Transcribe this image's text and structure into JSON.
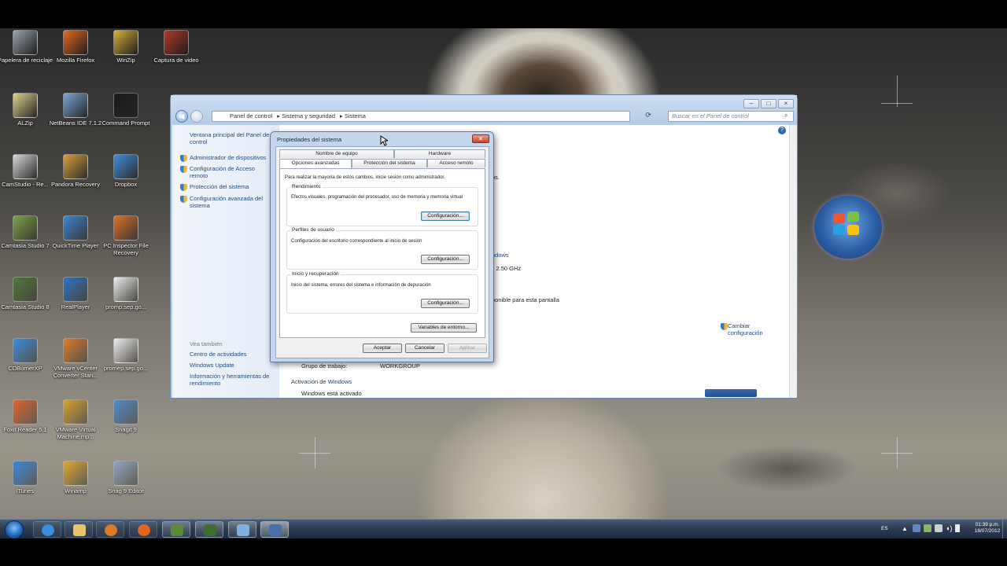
{
  "desktop": {
    "icons": [
      {
        "label": "Papelera de reciclaje",
        "glyph": "recycle-bin-icon",
        "color": "#9aa3ad"
      },
      {
        "label": "Mozilla Firefox",
        "glyph": "firefox-icon",
        "color": "#e66a1e"
      },
      {
        "label": "WinZip",
        "glyph": "winzip-icon",
        "color": "#d9b13a"
      },
      {
        "label": "Captura de video",
        "glyph": "video-folder-icon",
        "color": "#b43a2a"
      },
      {
        "label": "ALZip",
        "glyph": "alzip-icon",
        "color": "#e0d38a"
      },
      {
        "label": "NetBeans IDE 7.1.2",
        "glyph": "netbeans-icon",
        "color": "#7aa7d8"
      },
      {
        "label": "Command Prompt",
        "glyph": "command-prompt-icon",
        "color": "#1b1b1b"
      },
      {
        "label": "CamStudio - Re...",
        "glyph": "camstudio-icon",
        "color": "#d8d8d8"
      },
      {
        "label": "Pandora Recovery",
        "glyph": "pandora-icon",
        "color": "#d7a23a"
      },
      {
        "label": "Dropbox",
        "glyph": "dropbox-icon",
        "color": "#3f8fdd"
      },
      {
        "label": "Camtasia Studio 7",
        "glyph": "camtasia-icon",
        "color": "#7ea447"
      },
      {
        "label": "QuickTime Player",
        "glyph": "quicktime-icon",
        "color": "#3c88d6"
      },
      {
        "label": "PC Inspector File Recovery",
        "glyph": "pc-inspector-icon",
        "color": "#e0702a"
      },
      {
        "label": "Camtasia Studio 8",
        "glyph": "camtasia8-icon",
        "color": "#4e7a38"
      },
      {
        "label": "RealPlayer",
        "glyph": "realplayer-icon",
        "color": "#2c75c6"
      },
      {
        "label": "promp.sep.go...",
        "glyph": "document-icon",
        "color": "#eeeeee"
      },
      {
        "label": "CDBurnerXP",
        "glyph": "cdburner-icon",
        "color": "#3b8de0"
      },
      {
        "label": "VMware vCenter Converter Stan...",
        "glyph": "vmware-converter-icon",
        "color": "#e07b28"
      },
      {
        "label": "promep.sep.go...",
        "glyph": "document-icon",
        "color": "#eeeeee"
      },
      {
        "label": "Foxit Reader 5.1",
        "glyph": "foxit-icon",
        "color": "#e2632a"
      },
      {
        "label": "VMware Virtual Machine.mp...",
        "glyph": "vmware-vm-icon",
        "color": "#d9a02a"
      },
      {
        "label": "Snagit 9",
        "glyph": "snagit-icon",
        "color": "#4c8ccc"
      },
      {
        "label": "iTunes",
        "glyph": "itunes-icon",
        "color": "#3a88d9"
      },
      {
        "label": "Winamp",
        "glyph": "winamp-icon",
        "color": "#e1a52a"
      },
      {
        "label": "Snag 9 Editor",
        "glyph": "snagit-editor-icon",
        "color": "#8fa6c0"
      }
    ]
  },
  "explorer": {
    "breadcrumb": [
      "Panel de control",
      "Sistema y seguridad",
      "Sistema"
    ],
    "search_placeholder": "Buscar en el Panel de control",
    "left_title": "Ventana principal del Panel de control",
    "left_links": [
      "Administrador de dispositivos",
      "Configuración de Acceso remoto",
      "Protección del sistema",
      "Configuración avanzada del sistema"
    ],
    "see_also_title": "Vea también",
    "see_also": [
      "Centro de actividades",
      "Windows Update",
      "Información y herramientas de rendimiento"
    ],
    "frag_1": "os.",
    "frag_2": "ndows",
    "frag_3": "iz  2.50 GHz",
    "frag_4": "ponible para esta pantalla",
    "change_settings": "Cambiar configuración",
    "workgroup_label": "Grupo de trabajo:",
    "workgroup_value": "WORKGROUP",
    "activation_title": "Activación de Windows",
    "activation_status": "Windows está activado"
  },
  "dialog": {
    "title": "Propiedades del sistema",
    "tabs_row1": [
      "Nombre de equipo",
      "Hardware"
    ],
    "tabs_row2": [
      "Opciones avanzadas",
      "Protección del sistema",
      "Acceso remoto"
    ],
    "note": "Para realizar la mayoría de estos cambios, inicie sesión como administrador.",
    "performance_title": "Rendimiento",
    "performance_desc": "Efectos visuales, programación del procesador, uso de memoria y memoria virtual",
    "profiles_title": "Perfiles de usuario",
    "profiles_desc": "Configuración del escritorio correspondiente al inicio de sesión",
    "startup_title": "Inicio y recuperación",
    "startup_desc": "Inicio del sistema, errores del sistema e información de depuración",
    "settings_label": "Configuración...",
    "env_vars_label": "Variables de entorno...",
    "ok_label": "Aceptar",
    "cancel_label": "Cancelar",
    "apply_label": "Aplicar"
  },
  "taskbar": {
    "lang": "ES",
    "time": "01:39 p.m.",
    "date": "18/07/2012"
  }
}
